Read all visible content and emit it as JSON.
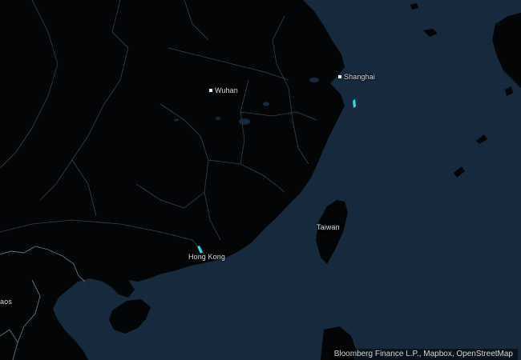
{
  "colors": {
    "ocean": "#17293c",
    "land": "#040506",
    "border": "#3b4148",
    "intl_border": "#6d7377",
    "highlight": "#35d8e8",
    "label": "#d8dde2"
  },
  "places": [
    {
      "name": "Wuhan",
      "kind": "city",
      "has_marker": true
    },
    {
      "name": "Shanghai",
      "kind": "city",
      "has_marker": true
    },
    {
      "name": "Taiwan",
      "kind": "region",
      "has_marker": false
    },
    {
      "name": "Hong Kong",
      "kind": "city",
      "has_marker": false
    },
    {
      "name": "aos",
      "kind": "country-partial",
      "has_marker": false
    }
  ],
  "highlights": [
    {
      "name": "hong-kong-highlight"
    },
    {
      "name": "zhejiang-coast-highlight"
    }
  ],
  "attribution": "Bloomberg Finance L.P., Mapbox, OpenStreetMap"
}
